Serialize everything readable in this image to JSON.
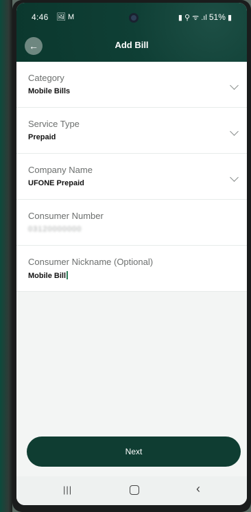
{
  "status_bar": {
    "time": "4:46",
    "left_icons": "🖼 M",
    "right_icons": "▮ ⚲ ᯤ .ıl",
    "battery": "51%"
  },
  "header": {
    "title": "Add Bill",
    "back_icon": "arrow-left-icon"
  },
  "fields": [
    {
      "label": "Category",
      "value": "Mobile Bills",
      "has_dropdown": true
    },
    {
      "label": "Service Type",
      "value": "Prepaid",
      "has_dropdown": true
    },
    {
      "label": "Company Name",
      "value": "UFONE Prepaid",
      "has_dropdown": true
    },
    {
      "label": "Consumer Number",
      "value": "03120000000",
      "has_dropdown": false
    },
    {
      "label": "Consumer Nickname (Optional)",
      "value": "Mobile Bill",
      "has_dropdown": false
    }
  ],
  "next_button": {
    "label": "Next"
  },
  "nav_bar": {
    "recents": "|||",
    "back": "‹"
  },
  "colors": {
    "brand_dark": "#0f3d32",
    "header_bg": "#0b382e",
    "screen_bg": "#f3f5f4"
  }
}
